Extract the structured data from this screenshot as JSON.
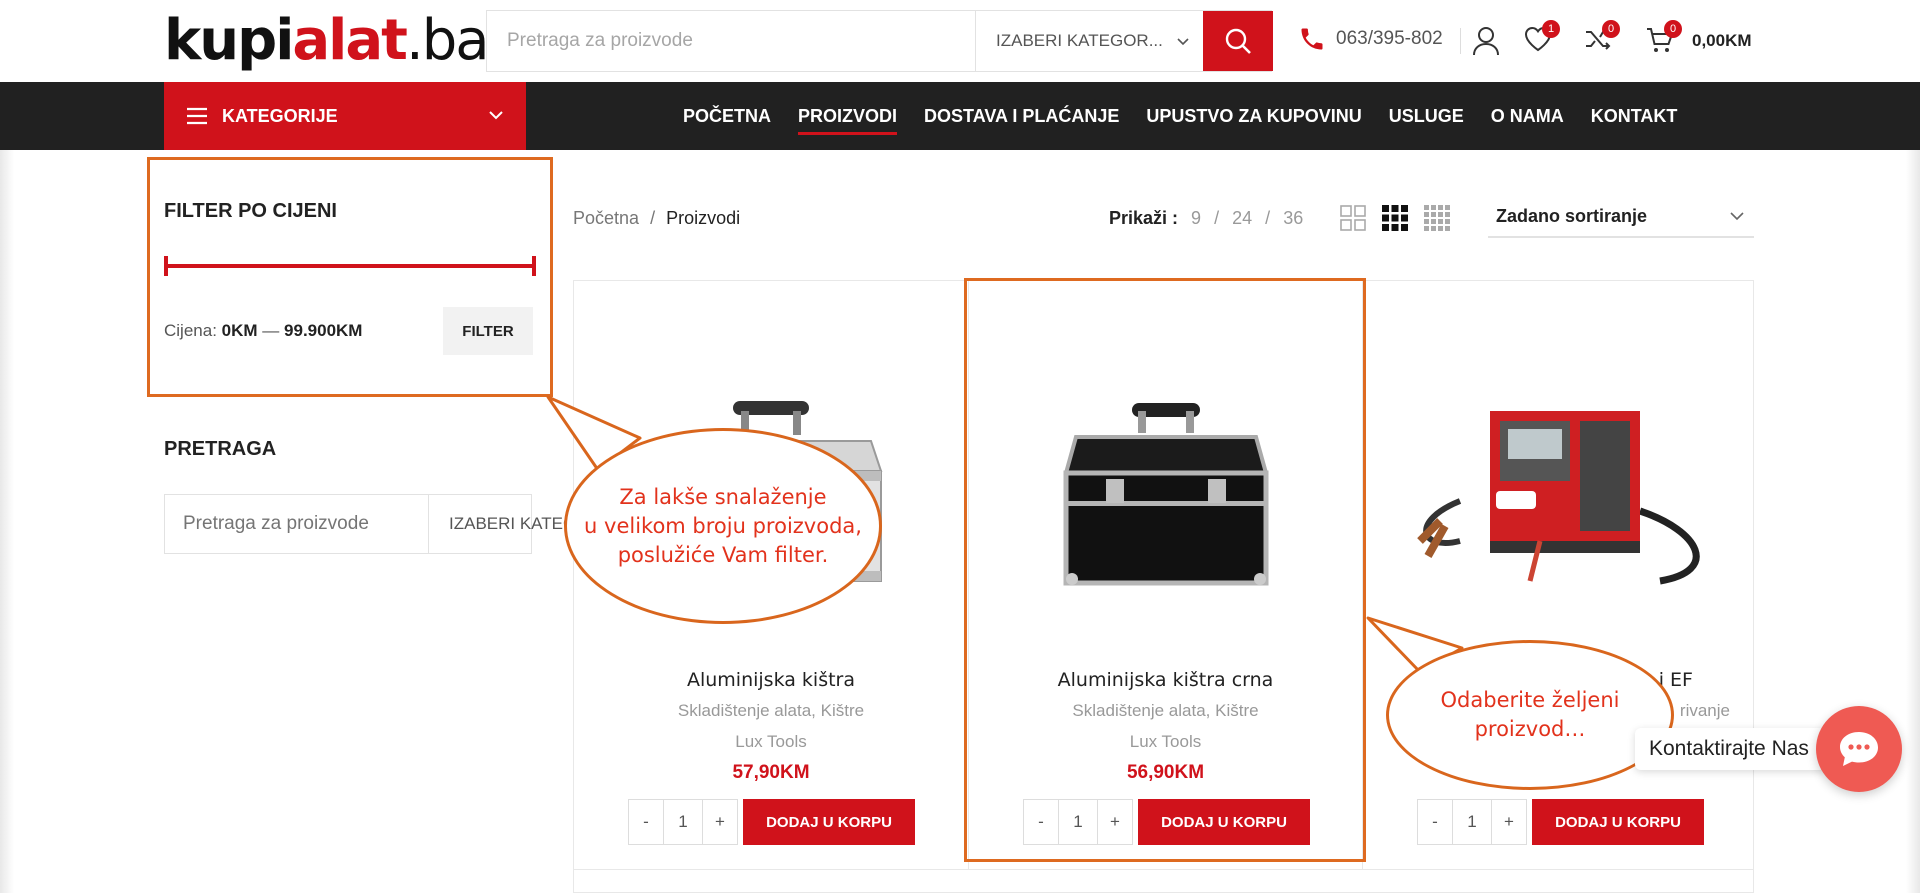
{
  "header": {
    "logo_part1": "kupi",
    "logo_part2": "alat",
    "logo_part3": ".ba",
    "search_placeholder": "Pretraga za proizvode",
    "category_select": "IZABERI KATEGOR...",
    "phone": "063/395-802",
    "wishlist_count": "1",
    "compare_count": "0",
    "cart_count": "0",
    "cart_total": "0,00KM"
  },
  "nav": {
    "categories_label": "KATEGORIJE",
    "links": [
      "POČETNA",
      "PROIZVODI",
      "DOSTAVA I PLAĆANJE",
      "UPUSTVO ZA KUPOVINU",
      "USLUGE",
      "O NAMA",
      "KONTAKT"
    ],
    "active": "PROIZVODI"
  },
  "sidebar": {
    "filter_title": "FILTER PO CIJENI",
    "price_label": "Cijena:",
    "price_min": "0KM",
    "price_sep": "—",
    "price_max": "99.900KM",
    "filter_button": "FILTER",
    "search_title": "PRETRAGA",
    "search_placeholder": "Pretraga za proizvode",
    "search_category": "IZABERI KATEGOR..."
  },
  "toolbar": {
    "breadcrumb_home": "Početna",
    "breadcrumb_sep": "/",
    "breadcrumb_current": "Proizvodi",
    "show_label": "Prikaži :",
    "per_page": [
      "9",
      "24",
      "36"
    ],
    "sort_label": "Zadano sortiranje"
  },
  "products": [
    {
      "title": "Aluminijska kištra",
      "categories": "Skladištenje alata, Kištre",
      "brand": "Lux Tools",
      "price": "57,90KM",
      "qty": "1",
      "button": "DODAJ U KORPU"
    },
    {
      "title": "Aluminijska kištra crna",
      "categories": "Skladištenje alata, Kištre",
      "brand": "Lux Tools",
      "price": "56,90KM",
      "qty": "1",
      "button": "DODAJ U KORPU"
    },
    {
      "title": "i EF",
      "categories": "rivanje",
      "brand": "",
      "price": "",
      "qty": "1",
      "button": "DODAJ U KORPU"
    }
  ],
  "qty_minus": "-",
  "qty_plus": "+",
  "annotations": {
    "bubble1_line1": "Za lakše snalaženje",
    "bubble1_line2": "u velikom broju proizvoda,",
    "bubble1_line3": "poslužiće Vam filter.",
    "bubble2_line1": "Odaberite željeni",
    "bubble2_line2": "proizvod…"
  },
  "chat": {
    "label": "Kontaktirajte Nas"
  },
  "colors": {
    "brand_red": "#d0121b",
    "nav_dark": "#212121",
    "annotation_orange": "#de6a20",
    "chat_coral": "#ef5a53"
  }
}
